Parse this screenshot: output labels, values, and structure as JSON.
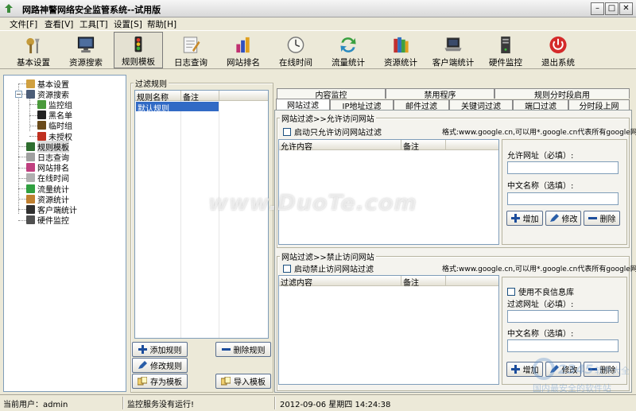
{
  "window": {
    "title": "网路神警网络安全监管系统--试用版"
  },
  "menu": [
    "文件[F]",
    "查看[V]",
    "工具[T]",
    "设置[S]",
    "帮助[H]"
  ],
  "toolbar": [
    {
      "label": "基本设置",
      "icon": "settings-icon"
    },
    {
      "label": "资源搜索",
      "icon": "monitor-icon"
    },
    {
      "label": "规则模板",
      "icon": "traffic-light-icon"
    },
    {
      "label": "日志查询",
      "icon": "log-icon"
    },
    {
      "label": "网站排名",
      "icon": "chart-icon"
    },
    {
      "label": "在线时间",
      "icon": "clock-icon"
    },
    {
      "label": "流量统计",
      "icon": "refresh-arrows-icon"
    },
    {
      "label": "资源统计",
      "icon": "books-icon"
    },
    {
      "label": "客户端统计",
      "icon": "laptop-icon"
    },
    {
      "label": "硬件监控",
      "icon": "server-icon"
    },
    {
      "label": "退出系统",
      "icon": "power-icon"
    }
  ],
  "tree": [
    {
      "label": "基本设置",
      "level": 1,
      "icon": "settings-icon",
      "color": "#d0a040"
    },
    {
      "label": "资源搜索",
      "level": 1,
      "icon": "monitor-icon",
      "color": "#4c5d78",
      "expanded": true
    },
    {
      "label": "监控组",
      "level": 2,
      "icon": "group-icon",
      "color": "#4a9a3c"
    },
    {
      "label": "黑名单",
      "level": 2,
      "icon": "user-black-icon",
      "color": "#222222"
    },
    {
      "label": "临时组",
      "level": 2,
      "icon": "user-temp-icon",
      "color": "#6a4a1a"
    },
    {
      "label": "未授权",
      "level": 2,
      "icon": "user-unauth-icon",
      "color": "#c03020"
    },
    {
      "label": "规则模板",
      "level": 1,
      "icon": "traffic-light-icon",
      "color": "#2f6e2f",
      "selected": true
    },
    {
      "label": "日志查询",
      "level": 1,
      "icon": "log-icon",
      "color": "#a0a0a0"
    },
    {
      "label": "网站排名",
      "level": 1,
      "icon": "chart-icon",
      "color": "#c04080"
    },
    {
      "label": "在线时间",
      "level": 1,
      "icon": "clock-icon",
      "color": "#b0b0b0"
    },
    {
      "label": "流量统计",
      "level": 1,
      "icon": "refresh-arrows-icon",
      "color": "#30a040"
    },
    {
      "label": "资源统计",
      "level": 1,
      "icon": "books-icon",
      "color": "#c08030"
    },
    {
      "label": "客户端统计",
      "level": 1,
      "icon": "laptop-icon",
      "color": "#303030"
    },
    {
      "label": "硬件监控",
      "level": 1,
      "icon": "server-icon",
      "color": "#505050"
    }
  ],
  "rules": {
    "group_title": "过滤规则",
    "columns": [
      "规则名称",
      "备注"
    ],
    "rows": [
      {
        "name": "默认规则",
        "note": ""
      }
    ],
    "buttons": {
      "add": "添加规则",
      "delete": "删除规则",
      "edit": "修改规则",
      "save": "存为模板",
      "import": "导入模板"
    }
  },
  "tabs_row1": [
    "内容监控",
    "禁用程序",
    "规则分时段启用"
  ],
  "tabs_row2": [
    "网站过滤",
    "IP地址过滤",
    "邮件过滤",
    "关键词过滤",
    "端口过滤",
    "分时段上网"
  ],
  "allow": {
    "title": "网站过滤>>允许访问网站",
    "checkbox": "启动只允许访问网站过滤",
    "hint": "格式:www.google.cn,可以用*.google.cn代表所有google网页",
    "columns": [
      "允许内容",
      "备注"
    ],
    "url_label": "允许网址（必填）:",
    "cn_label": "中文名称（选填）:",
    "add": "增加",
    "edit": "修改",
    "delete": "删除"
  },
  "block": {
    "title": "网站过滤>>禁止访问网站",
    "checkbox": "启动禁止访问网站过滤",
    "hint": "格式:www.google.cn,可以用*.google.cn代表所有google网页",
    "columns": [
      "过滤内容",
      "备注"
    ],
    "badlib_label": "使用不良信息库",
    "url_label": "过滤网址（必填）:",
    "cn_label": "中文名称（选填）:",
    "add": "增加",
    "edit": "修改",
    "delete": "删除"
  },
  "status": {
    "user": "当前用户：admin",
    "service": "监控服务没有运行!",
    "datetime": "2012-09-06  星期四  14:24:38"
  },
  "watermark": "www.DuoTe.com",
  "logo_watermark": {
    "brand": "2345软件大全",
    "slogan": "国内最安全的软件站"
  },
  "colors": {
    "selection": "#316ac5",
    "accent": "#3a6ea5"
  }
}
